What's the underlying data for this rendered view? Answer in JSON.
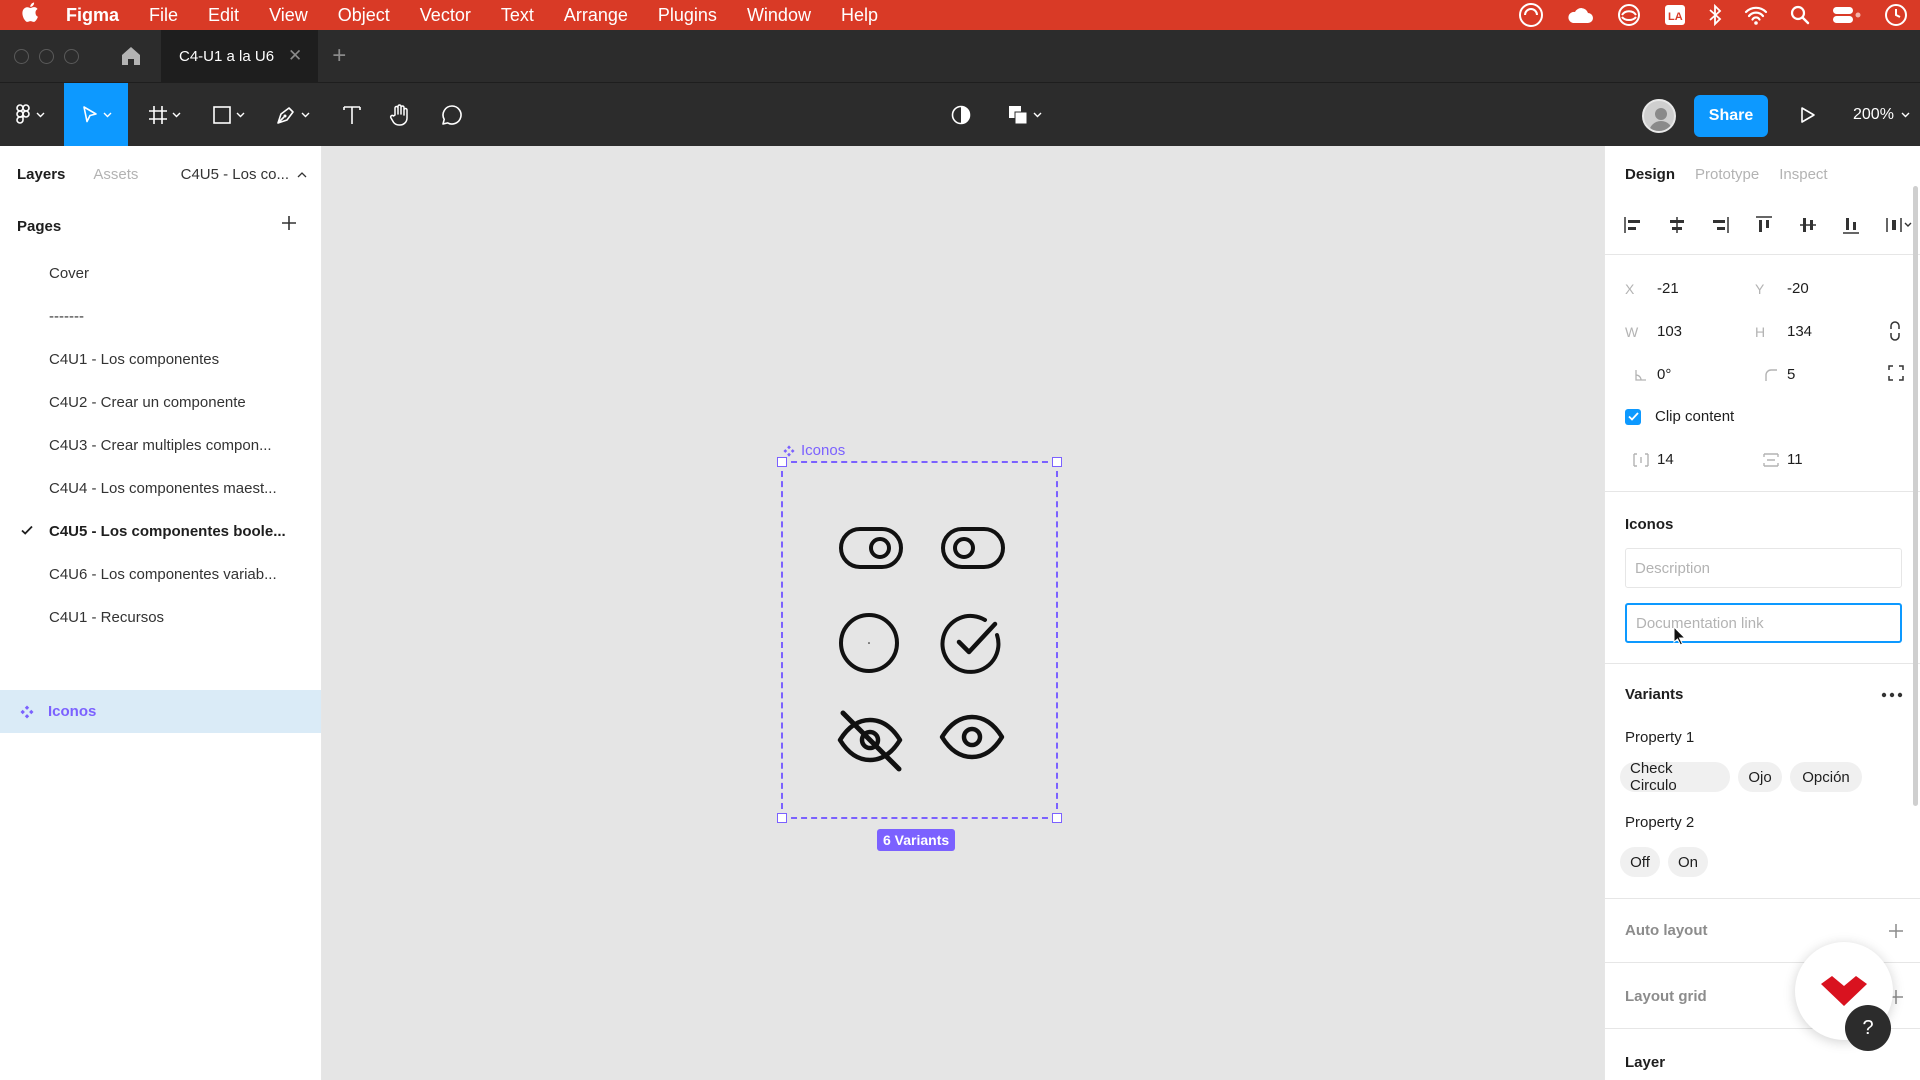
{
  "menubar": {
    "apple": "",
    "app": "Figma",
    "items": [
      "File",
      "Edit",
      "View",
      "Object",
      "Vector",
      "Text",
      "Arrange",
      "Plugins",
      "Window",
      "Help"
    ]
  },
  "tabbar": {
    "doc_tab": "C4-U1 a la U6",
    "close": "✕",
    "new_tab": "+"
  },
  "toolbar": {
    "share_label": "Share",
    "zoom": "200%"
  },
  "left_panel": {
    "tabs": [
      "Layers",
      "Assets"
    ],
    "page_selector": "C4U5 - Los co...",
    "pages_heading": "Pages",
    "pages": [
      "Cover",
      "-------",
      "C4U1 - Los componentes",
      "C4U2 - Crear un componente",
      "C4U3 - Crear multiples compon...",
      "C4U4 - Los componentes maest...",
      "C4U5 - Los componentes boole...",
      "C4U6 - Los componentes variab...",
      "C4U1 - Recursos"
    ],
    "current_page": "C4U5 - Los componentes boole...",
    "layer": "Iconos"
  },
  "canvas": {
    "frame_label": "Iconos",
    "variants_badge": "6 Variants"
  },
  "right_panel": {
    "tabs": [
      "Design",
      "Prototype",
      "Inspect"
    ],
    "x_label": "X",
    "x": "-21",
    "y_label": "Y",
    "y": "-20",
    "w_label": "W",
    "w": "103",
    "h_label": "H",
    "h": "134",
    "rotation": "0°",
    "radius": "5",
    "clip_content": "Clip content",
    "gap_horizontal": "14",
    "gap_vertical": "11",
    "component_title": "Iconos",
    "description_placeholder": "Description",
    "doc_link_placeholder": "Documentation link",
    "variants_title": "Variants",
    "property1_label": "Property 1",
    "property1_values": [
      "Check Circulo",
      "Ojo",
      "Opción"
    ],
    "property2_label": "Property 2",
    "property2_values": [
      "Off",
      "On"
    ],
    "auto_layout": "Auto layout",
    "layout_grid": "Layout grid",
    "layer": "Layer"
  },
  "help": "?",
  "colors": {
    "menubar": "#d93a26",
    "accent": "#0d99ff",
    "component": "#7b61ff"
  }
}
